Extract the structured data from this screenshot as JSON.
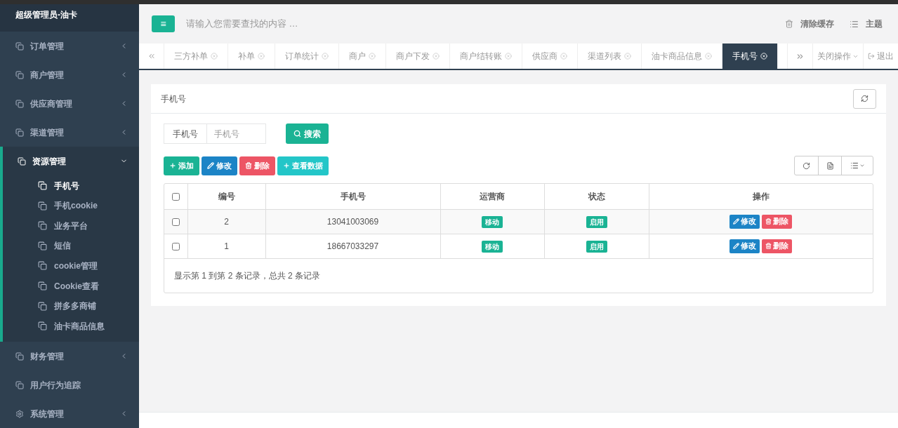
{
  "sidebar": {
    "title": "超级管理员-油卡",
    "items": [
      {
        "kind": "group",
        "label": "订单管理",
        "expanded": false
      },
      {
        "kind": "group",
        "label": "商户管理",
        "expanded": false
      },
      {
        "kind": "group",
        "label": "供应商管理",
        "expanded": false
      },
      {
        "kind": "group",
        "label": "渠道管理",
        "expanded": false
      },
      {
        "kind": "group",
        "label": "资源管理",
        "expanded": true,
        "children": [
          {
            "label": "手机号",
            "selected": true
          },
          {
            "label": "手机cookie",
            "selected": false
          },
          {
            "label": "业务平台",
            "selected": false
          },
          {
            "label": "短信",
            "selected": false
          },
          {
            "label": "cookie管理",
            "selected": false
          },
          {
            "label": "Cookie查看",
            "selected": false
          },
          {
            "label": "拼多多商铺",
            "selected": false
          },
          {
            "label": "油卡商品信息",
            "selected": false
          }
        ]
      },
      {
        "kind": "group",
        "label": "财务管理",
        "expanded": false
      },
      {
        "kind": "link",
        "label": "用户行为追踪"
      },
      {
        "kind": "settings",
        "label": "系统管理",
        "expanded": false
      }
    ]
  },
  "header": {
    "menu_button": "≡",
    "search_placeholder": "请输入您需要查找的内容 …",
    "actions": [
      "清除缓存",
      "主题"
    ]
  },
  "tabs": [
    {
      "label": "三方补单",
      "selected": false
    },
    {
      "label": "补单",
      "selected": false
    },
    {
      "label": "订单统计",
      "selected": false
    },
    {
      "label": "商户",
      "selected": false
    },
    {
      "label": "商户下发",
      "selected": false
    },
    {
      "label": "商户结转账",
      "selected": false
    },
    {
      "label": "供应商",
      "selected": false
    },
    {
      "label": "渠道列表",
      "selected": false
    },
    {
      "label": "油卡商品信息",
      "selected": false
    },
    {
      "label": "手机号",
      "selected": true
    }
  ],
  "tab_actions": {
    "close_menu": "关闭操作",
    "logout": "退出"
  },
  "panel": {
    "title": "手机号",
    "filter": {
      "label": "手机号",
      "placeholder": "手机号",
      "search_button": "搜索"
    },
    "toolbar": [
      {
        "kind": "add",
        "label": "添加"
      },
      {
        "kind": "edit",
        "label": "修改"
      },
      {
        "kind": "delete",
        "label": "删除"
      },
      {
        "kind": "view",
        "label": "查看数据"
      }
    ],
    "table": {
      "select_all": {
        "checked": false
      },
      "columns": [
        "编号",
        "手机号",
        "运营商",
        "状态",
        "操作"
      ],
      "rows": [
        {
          "checked": false,
          "id": "2",
          "phone": "13041003069",
          "carrier": "移动",
          "status": "启用",
          "actions": [
            "修改",
            "删除"
          ]
        },
        {
          "checked": false,
          "id": "1",
          "phone": "18667033297",
          "carrier": "移动",
          "status": "启用",
          "actions": [
            "修改",
            "删除"
          ]
        }
      ]
    },
    "pagination_info": "显示第 1 到第 2 条记录，总共 2 条记录"
  }
}
